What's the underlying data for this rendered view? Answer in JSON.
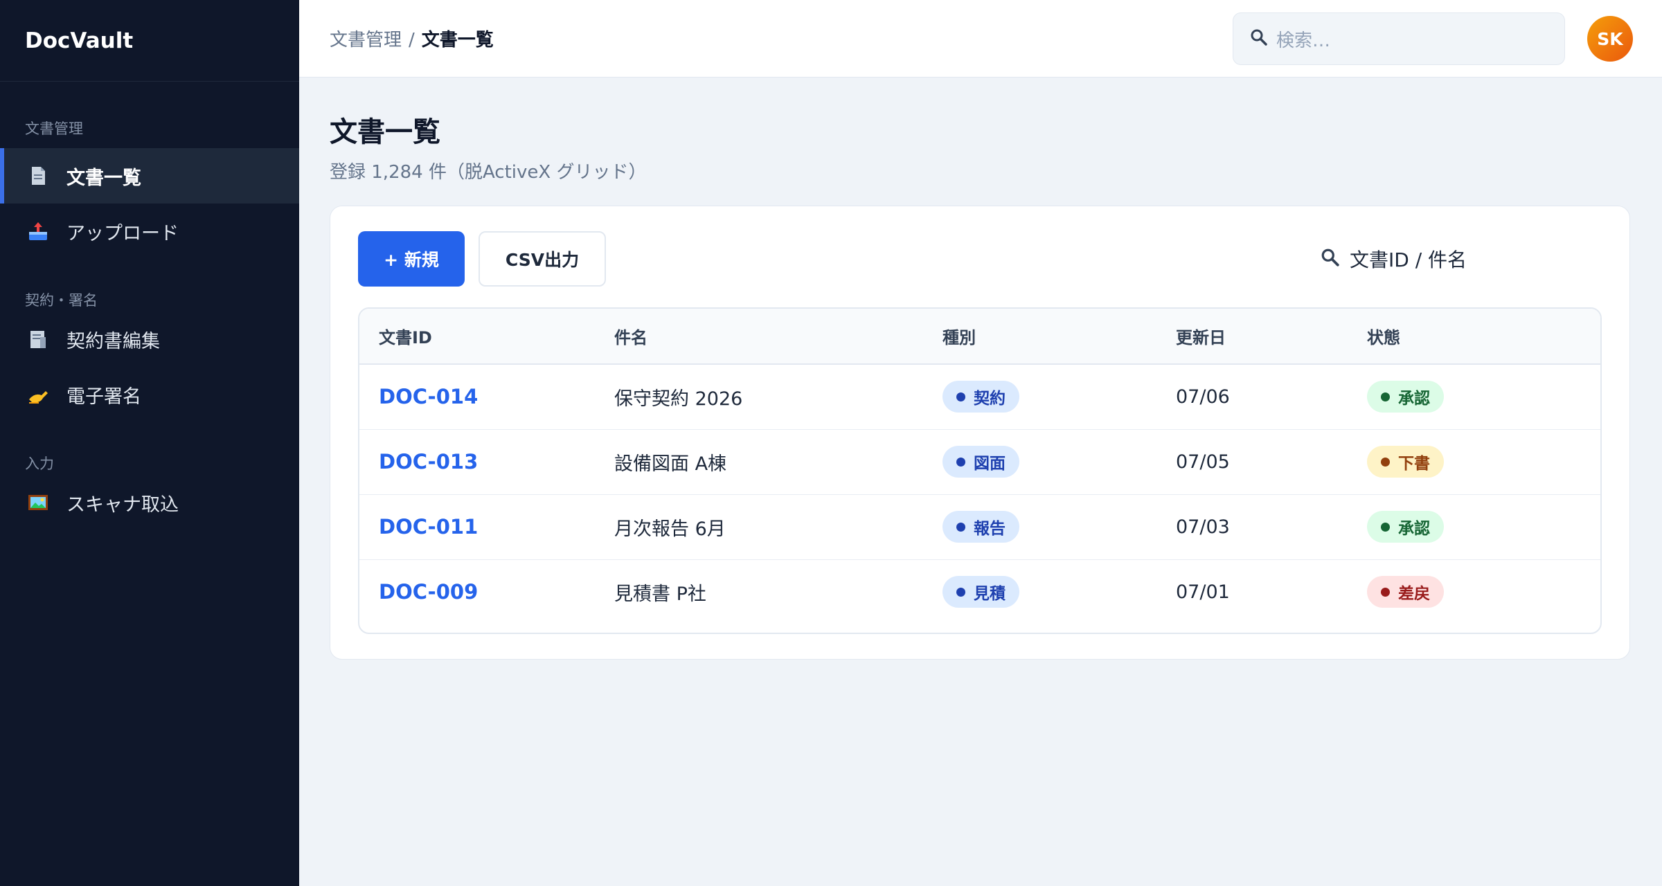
{
  "app": {
    "name": "DocVault"
  },
  "sidebar": {
    "sections": [
      {
        "label": "文書管理",
        "items": [
          {
            "label": "文書一覧",
            "icon": "document-icon",
            "active": true
          },
          {
            "label": "アップロード",
            "icon": "upload-tray-icon",
            "active": false
          }
        ]
      },
      {
        "label": "契約・署名",
        "items": [
          {
            "label": "契約書編集",
            "icon": "contract-edit-icon",
            "active": false
          },
          {
            "label": "電子署名",
            "icon": "writing-hand-icon",
            "active": false
          }
        ]
      },
      {
        "label": "入力",
        "items": [
          {
            "label": "スキャナ取込",
            "icon": "image-icon",
            "active": false
          }
        ]
      }
    ]
  },
  "topbar": {
    "breadcrumb": {
      "parent": "文書管理",
      "separator": "/",
      "current": "文書一覧"
    },
    "search_placeholder": "検索…",
    "avatar_initials": "SK"
  },
  "page": {
    "title": "文書一覧",
    "subtitle": "登録 1,284 件（脱ActiveX グリッド）"
  },
  "toolbar": {
    "new_label": "+ 新規",
    "csv_label": "CSV出力",
    "search_placeholder": "文書ID / 件名"
  },
  "table": {
    "columns": [
      "文書ID",
      "件名",
      "種別",
      "更新日",
      "状態"
    ],
    "rows": [
      {
        "id": "DOC-014",
        "title": "保守契約 2026",
        "type": "契約",
        "date": "07/06",
        "status": "承認",
        "status_kind": "approved"
      },
      {
        "id": "DOC-013",
        "title": "設備図面 A棟",
        "type": "図面",
        "date": "07/05",
        "status": "下書",
        "status_kind": "draft"
      },
      {
        "id": "DOC-011",
        "title": "月次報告 6月",
        "type": "報告",
        "date": "07/03",
        "status": "承認",
        "status_kind": "approved"
      },
      {
        "id": "DOC-009",
        "title": "見積書 P社",
        "type": "見積",
        "date": "07/01",
        "status": "差戻",
        "status_kind": "returned"
      }
    ]
  },
  "colors": {
    "sidebar_bg": "#0f172a",
    "accent": "#2563eb",
    "approved": "#166534",
    "draft": "#92400e",
    "returned": "#991b1b"
  }
}
